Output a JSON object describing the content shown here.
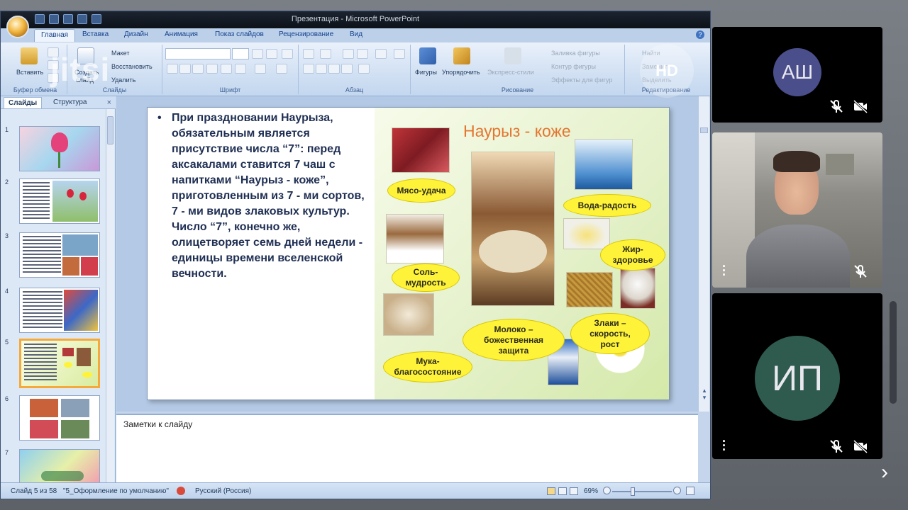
{
  "window": {
    "title": "Презентация - Microsoft PowerPoint"
  },
  "ribbon_tabs": [
    "Главная",
    "Вставка",
    "Дизайн",
    "Анимация",
    "Показ слайдов",
    "Рецензирование",
    "Вид"
  ],
  "ribbon": {
    "clipboard": {
      "paste": "Вставить",
      "label": "Буфер обмена"
    },
    "slides": {
      "create_line1": "Создать",
      "create_line2": "слайд",
      "layout": "Макет",
      "reset": "Восстановить",
      "delete": "Удалить",
      "label": "Слайды"
    },
    "font": {
      "label": "Шрифт"
    },
    "paragraph": {
      "label": "Абзац"
    },
    "drawing": {
      "shapes": "Фигуры",
      "arrange": "Упорядочить",
      "quick_styles": "Экспресс-стили",
      "fill": "Заливка фигуры",
      "outline": "Контур фигуры",
      "effects": "Эффекты для фигур",
      "label": "Рисование"
    },
    "editing": {
      "find": "Найти",
      "replace": "Заменить",
      "select": "Выделить",
      "label": "Редактирование"
    }
  },
  "watermark": "jitsi",
  "hd_badge": "HD",
  "left_panel": {
    "tabs": [
      "Слайды",
      "Структура"
    ],
    "close": "×",
    "slides": [
      {
        "num": "1"
      },
      {
        "num": "2"
      },
      {
        "num": "3"
      },
      {
        "num": "4"
      },
      {
        "num": "5",
        "selected": true
      },
      {
        "num": "6"
      },
      {
        "num": "7"
      }
    ]
  },
  "slide": {
    "bullet": "•",
    "text": "При праздновании Наурыза, обязательным является присутствие числа “7”: перед аксакалами ставится 7 чаш с напитками “Наурыз - коже”, приготовленным из 7 - ми сортов, 7 - ми видов злаковых культур. Число “7”, конечно же, олицетворяет семь дней недели - единицы времени вселенской вечности.",
    "collage_title": "Наурыз - коже",
    "bubbles": {
      "meat": "Мясо-удача",
      "water": "Вода-радость",
      "fat": "Жир-здоровье",
      "salt": "Соль-мудрость",
      "milk": "Молоко – божественная защита",
      "grain": "Злаки – скорость, рост",
      "flour": "Мука-благосостояние"
    }
  },
  "notes": {
    "placeholder": "Заметки к слайду"
  },
  "status_bar": {
    "slide_counter": "Слайд 5 из 58",
    "theme": "\"5_Оформление по умолчанию\"",
    "language": "Русский (Россия)",
    "zoom": "69%"
  },
  "participants": [
    {
      "initials": "АШ",
      "avatar_color": "#4a4f8c",
      "mic_muted": true,
      "camera_off": true
    },
    {
      "initials": "",
      "video": true,
      "mic_muted": true
    },
    {
      "initials": "ИП",
      "avatar_color": "#2f5b4f",
      "mic_muted": true,
      "camera_off": true
    }
  ],
  "colors": {
    "title_orange": "#e4762f",
    "bubble_yellow": "#fff33a",
    "slide_text": "#1f2f53",
    "selected_thumb_border": "#f6a93b"
  }
}
